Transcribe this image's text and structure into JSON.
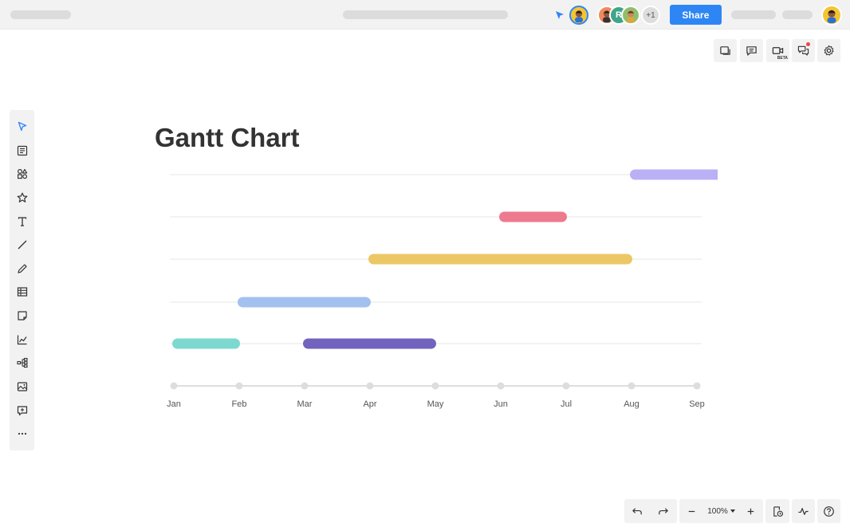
{
  "header": {
    "share_label": "Share",
    "more_collaborators": "+1",
    "collaborator_letter": "R"
  },
  "canvas": {
    "title": "Gantt Chart"
  },
  "right_toolbar": {
    "video_badge": "BETA"
  },
  "bottom_toolbar": {
    "zoom_level": "100%"
  },
  "colors": {
    "accent": "#2e86f5",
    "bar_purple_light": "#b9b0f5",
    "bar_pink": "#ee7a8e",
    "bar_yellow": "#ecc766",
    "bar_blue": "#a3c1ee",
    "bar_teal": "#7dd8d0",
    "bar_purple_dark": "#7264be"
  },
  "chart_data": {
    "type": "gantt",
    "title": "Gantt Chart",
    "x_tick_labels": [
      "Jan",
      "Feb",
      "Mar",
      "Apr",
      "May",
      "Jun",
      "Jul",
      "Aug",
      "Sep"
    ],
    "rows": [
      {
        "bars": [
          {
            "start": 7.0,
            "end": 9.0,
            "color": "#b9b0f5"
          }
        ]
      },
      {
        "bars": [
          {
            "start": 5.0,
            "end": 6.0,
            "color": "#ee7a8e"
          }
        ]
      },
      {
        "bars": [
          {
            "start": 3.0,
            "end": 7.0,
            "color": "#ecc766"
          }
        ]
      },
      {
        "bars": [
          {
            "start": 1.0,
            "end": 3.0,
            "color": "#a3c1ee"
          }
        ]
      },
      {
        "bars": [
          {
            "start": 0.0,
            "end": 1.0,
            "color": "#7dd8d0"
          },
          {
            "start": 2.0,
            "end": 4.0,
            "color": "#7264be"
          }
        ]
      }
    ]
  }
}
